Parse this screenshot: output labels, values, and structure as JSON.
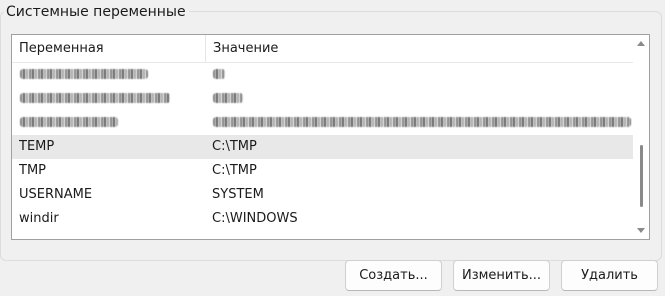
{
  "group": {
    "title": "Системные переменные"
  },
  "list": {
    "columns": {
      "variable": "Переменная",
      "value": "Значение"
    },
    "rows": [
      {
        "name": "",
        "value": "",
        "redacted": true
      },
      {
        "name": "",
        "value": "",
        "redacted": true
      },
      {
        "name": "",
        "value": "",
        "redacted": true
      },
      {
        "name": "TEMP",
        "value": "C:\\TMP",
        "selected": true
      },
      {
        "name": "TMP",
        "value": "C:\\TMP"
      },
      {
        "name": "USERNAME",
        "value": "SYSTEM"
      },
      {
        "name": "windir",
        "value": "C:\\WINDOWS"
      }
    ]
  },
  "buttons": {
    "create": "Создать...",
    "edit": "Изменить...",
    "delete": "Удалить"
  },
  "icons": {
    "scroll_up": "chevron-up-icon",
    "scroll_down": "chevron-down-icon"
  }
}
